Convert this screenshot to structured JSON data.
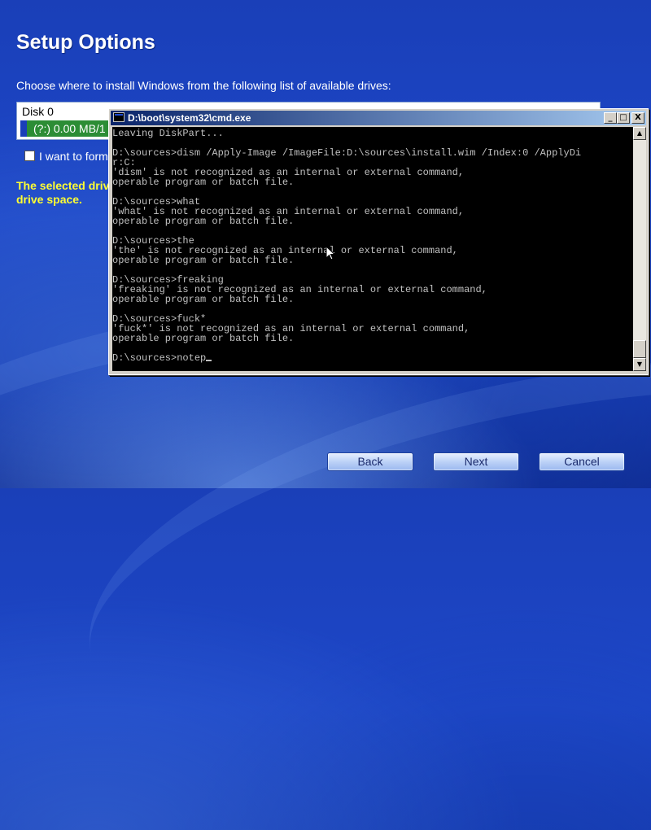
{
  "setup": {
    "title": "Setup Options",
    "instruction": "Choose where to install Windows from the following list of available drives:",
    "drive_list": {
      "disk_label": "Disk 0",
      "partition_label": "(?:) 0.00 MB/1"
    },
    "format_checkbox_label": "I want to form",
    "warning_line1": "The selected drive",
    "warning_line2": "drive space."
  },
  "cmd_window": {
    "title": "D:\\boot\\system32\\cmd.exe",
    "minimize_glyph": "_",
    "maximize_glyph": "□",
    "close_glyph": "X",
    "lines": [
      "Leaving DiskPart...",
      "",
      "D:\\sources>dism /Apply-Image /ImageFile:D:\\sources\\install.wim /Index:0 /ApplyDi",
      "r:C:",
      "'dism' is not recognized as an internal or external command,",
      "operable program or batch file.",
      "",
      "D:\\sources>what",
      "'what' is not recognized as an internal or external command,",
      "operable program or batch file.",
      "",
      "D:\\sources>the",
      "'the' is not recognized as an internal or external command,",
      "operable program or batch file.",
      "",
      "D:\\sources>freaking",
      "'freaking' is not recognized as an internal or external command,",
      "operable program or batch file.",
      "",
      "D:\\sources>fuck*",
      "'fuck*' is not recognized as an internal or external command,",
      "operable program or batch file.",
      ""
    ],
    "prompt_line": "D:\\sources>notep",
    "scroll_up_glyph": "▲",
    "scroll_down_glyph": "▼"
  },
  "buttons": {
    "back": "Back",
    "next": "Next",
    "cancel": "Cancel"
  },
  "colors": {
    "background": "#1a3fb8",
    "warning_text": "#ffff33",
    "partition_selected": "#2c8d35",
    "console_background": "#000000",
    "console_text": "#c0c0c0"
  }
}
